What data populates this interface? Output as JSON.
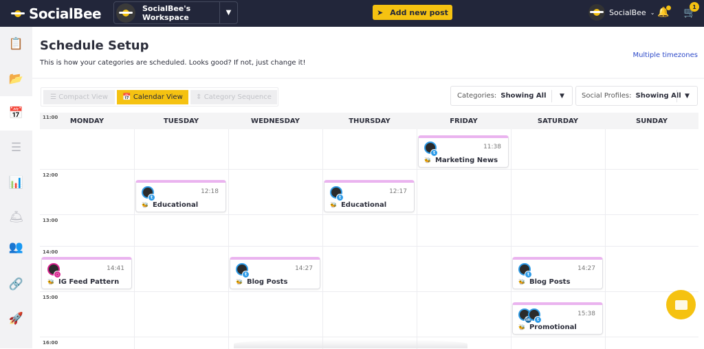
{
  "header": {
    "logo": "SocialBee",
    "workspace": "SocialBee's Workspace",
    "add_post": "Add new post",
    "user": "SocialBee",
    "cart_count": "1"
  },
  "sidebar": {
    "items": [
      {
        "icon": "clipboard-icon"
      },
      {
        "icon": "folder-icon"
      },
      {
        "icon": "calendar-edit-icon",
        "active": true
      },
      {
        "icon": "list-icon"
      },
      {
        "icon": "analytics-icon"
      },
      {
        "icon": "concierge-bell-icon"
      },
      {
        "icon": "users-icon"
      },
      {
        "icon": "link-icon"
      },
      {
        "icon": "rocket-icon"
      }
    ]
  },
  "page": {
    "title": "Schedule Setup",
    "subtitle": "This is how your categories are scheduled. Looks good? If not, just change it!",
    "timezones_link": "Multiple timezones"
  },
  "views": {
    "compact": "Compact View",
    "calendar": "Calendar View",
    "sequence": "Category Sequence",
    "active": "calendar"
  },
  "filters": {
    "categories_label": "Categories:",
    "categories_value": "Showing All",
    "profiles_label": "Social Profiles:",
    "profiles_value": "Showing All"
  },
  "calendar": {
    "days": [
      "MONDAY",
      "TUESDAY",
      "WEDNESDAY",
      "THURSDAY",
      "FRIDAY",
      "SATURDAY",
      "SUNDAY"
    ],
    "hours": [
      "11:00",
      "12:00",
      "13:00",
      "14:00",
      "15:00",
      "16:00"
    ],
    "events": [
      {
        "day": 4,
        "hour": "11:00",
        "time": "11:38",
        "category": "Marketing News",
        "networks": [
          "twitter"
        ]
      },
      {
        "day": 1,
        "hour": "12:00",
        "time": "12:18",
        "category": "Educational",
        "networks": [
          "twitter"
        ]
      },
      {
        "day": 3,
        "hour": "12:00",
        "time": "12:17",
        "category": "Educational",
        "networks": [
          "twitter"
        ]
      },
      {
        "day": 0,
        "hour": "14:00",
        "time": "14:41",
        "category": "IG Feed Pattern",
        "networks": [
          "instagram"
        ]
      },
      {
        "day": 2,
        "hour": "14:00",
        "time": "14:27",
        "category": "Blog Posts",
        "networks": [
          "twitter"
        ]
      },
      {
        "day": 5,
        "hour": "14:00",
        "time": "14:27",
        "category": "Blog Posts",
        "networks": [
          "twitter"
        ]
      },
      {
        "day": 5,
        "hour": "15:00",
        "time": "15:38",
        "category": "Promotional",
        "networks": [
          "linkedin",
          "twitter"
        ]
      }
    ],
    "category_color": "#eab3ef"
  },
  "colors": {
    "accent": "#f5c211",
    "topbar": "#22263a",
    "link": "#2a47c8"
  }
}
